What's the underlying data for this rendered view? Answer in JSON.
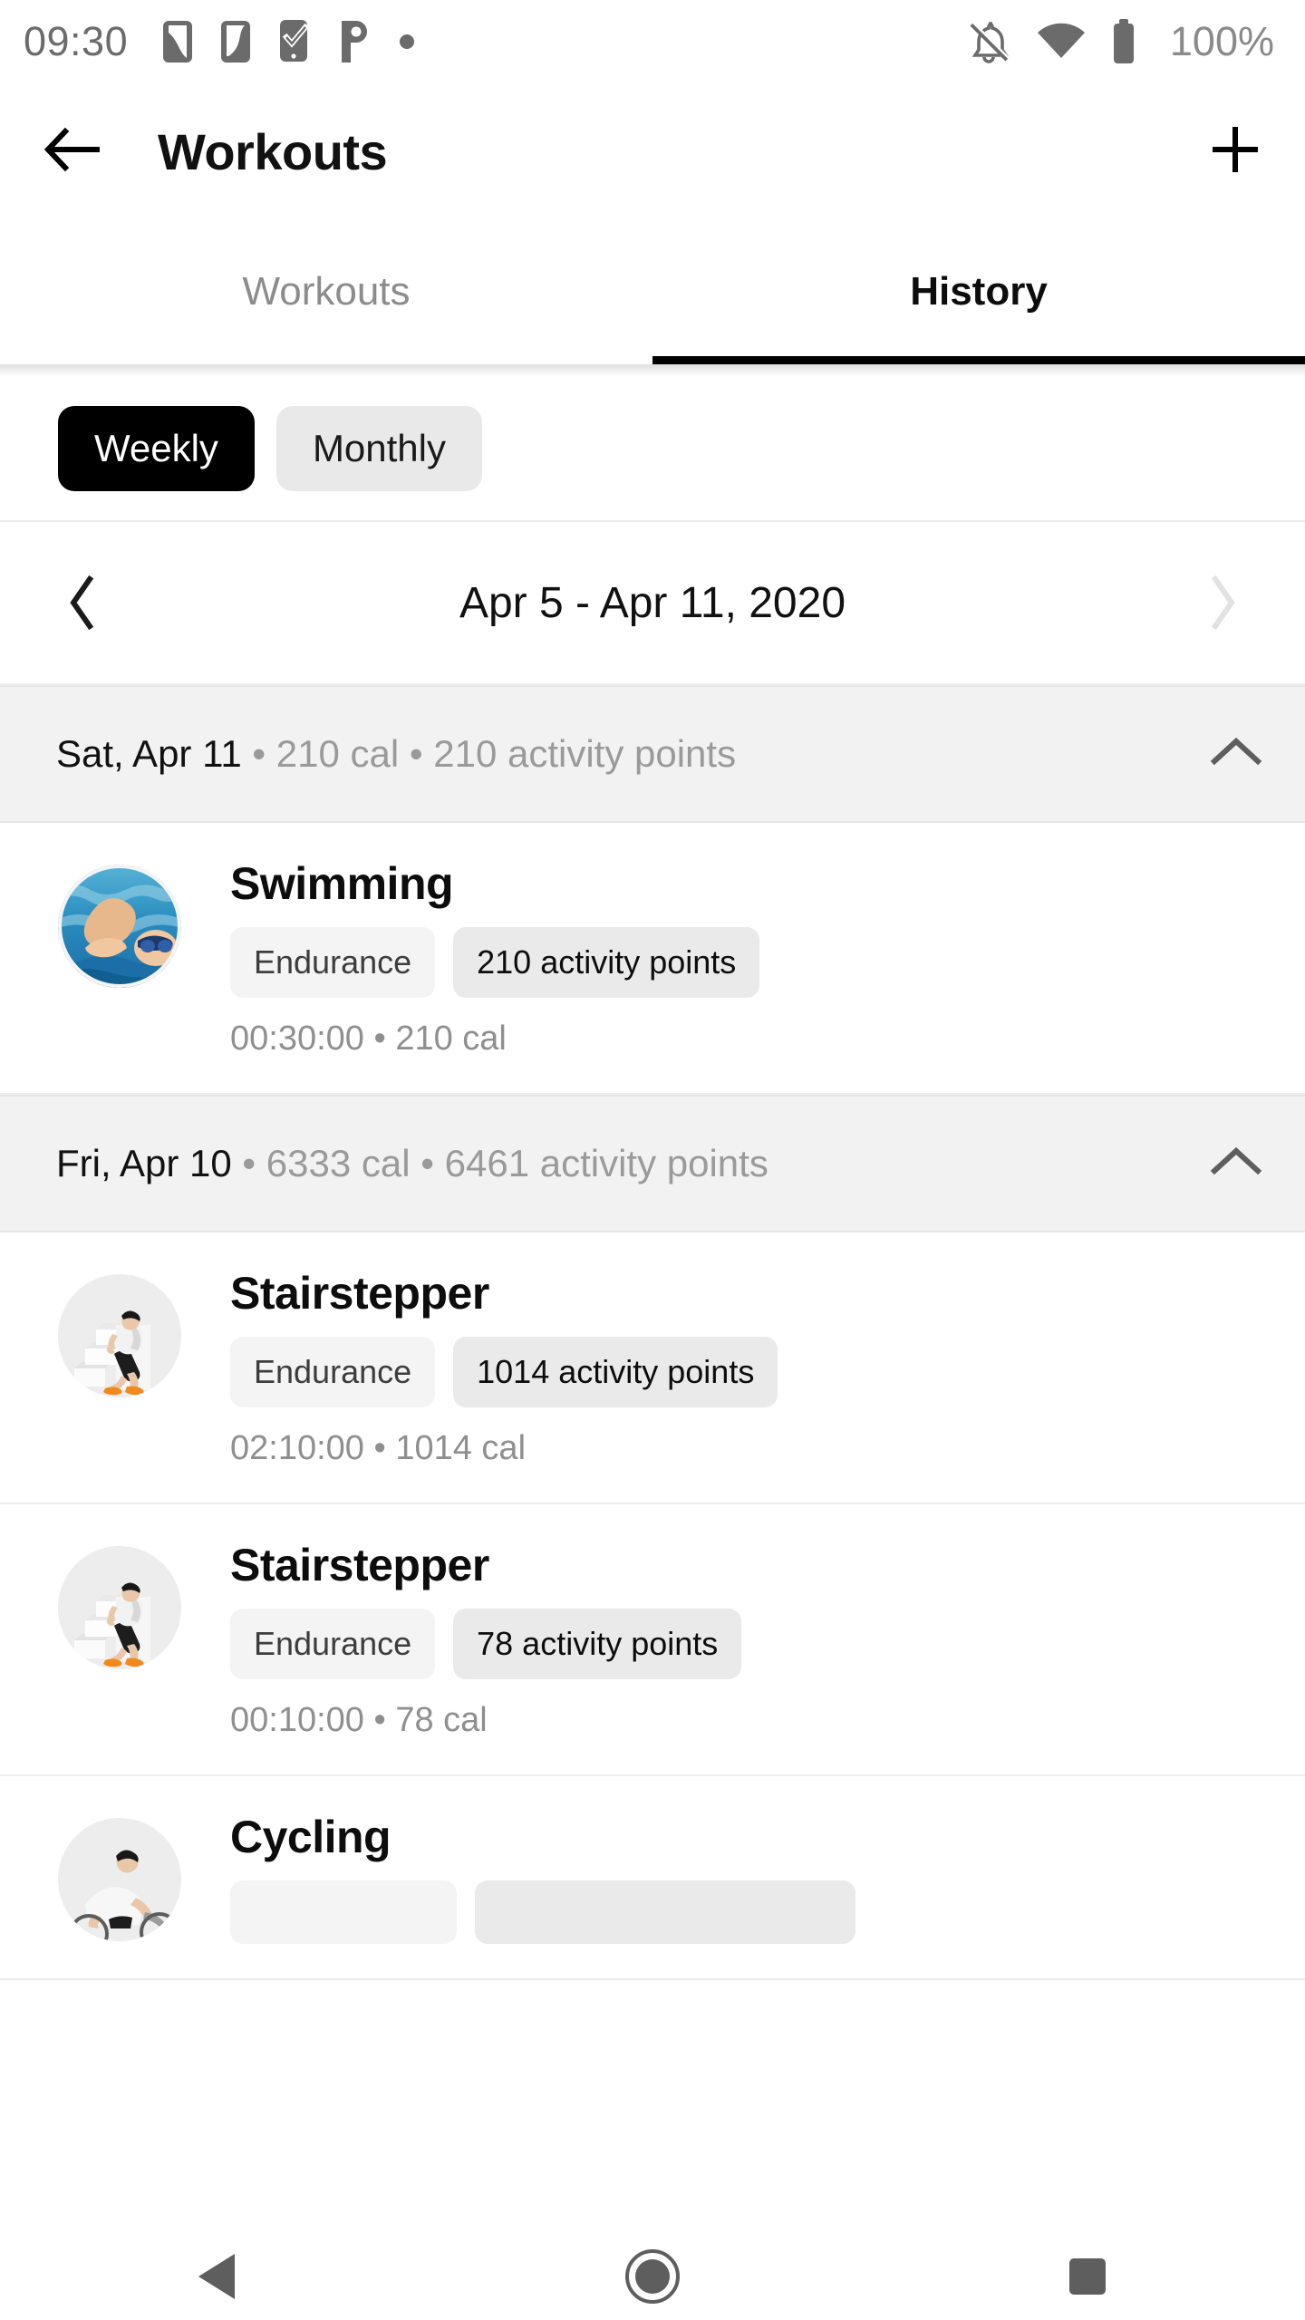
{
  "status_bar": {
    "time": "09:30",
    "battery_percent": "100%",
    "left_icons": [
      "sim-card-icon",
      "sim-card-icon",
      "phone-check-icon",
      "letter-p-icon",
      "dot-icon"
    ],
    "right_icons": [
      "notifications-off-icon",
      "wifi-icon",
      "battery-full-icon"
    ]
  },
  "app_bar": {
    "back_icon": "arrow-back-icon",
    "title": "Workouts",
    "add_icon": "plus-icon"
  },
  "tabs": [
    {
      "label": "Workouts",
      "active": false
    },
    {
      "label": "History",
      "active": true
    }
  ],
  "period_toggle": {
    "options": [
      {
        "label": "Weekly",
        "selected": true
      },
      {
        "label": "Monthly",
        "selected": false
      }
    ]
  },
  "date_nav": {
    "prev_icon": "chevron-left-icon",
    "next_icon": "chevron-right-icon",
    "range_label": "Apr 5 - Apr 11, 2020",
    "prev_enabled": true,
    "next_enabled": false
  },
  "days": [
    {
      "date_label": "Sat, Apr 11",
      "meta": " • 210 cal • 210 activity points",
      "collapse_icon": "chevron-up-icon",
      "workouts": [
        {
          "avatar": "swimming-photo",
          "title": "Swimming",
          "category": "Endurance",
          "points": "210 activity points",
          "meta": "00:30:00 • 210 cal"
        }
      ]
    },
    {
      "date_label": "Fri, Apr 10",
      "meta": " • 6333 cal • 6461 activity points",
      "collapse_icon": "chevron-up-icon",
      "workouts": [
        {
          "avatar": "stairstepper-photo",
          "title": "Stairstepper",
          "category": "Endurance",
          "points": "1014 activity points",
          "meta": "02:10:00 • 1014 cal"
        },
        {
          "avatar": "stairstepper-photo",
          "title": "Stairstepper",
          "category": "Endurance",
          "points": "78 activity points",
          "meta": "00:10:00 • 78 cal"
        },
        {
          "avatar": "cycling-photo",
          "title": "Cycling",
          "category": "",
          "points": "",
          "meta": ""
        }
      ]
    }
  ],
  "nav_bar": {
    "back": "triangle-back-icon",
    "home": "circle-home-icon",
    "recents": "square-recents-icon"
  },
  "colors": {
    "accent": "#000000",
    "muted_text": "#9a9a9a",
    "day_header_bg": "#f2f2f2",
    "chip_category_bg": "#f4f4f4",
    "chip_points_bg": "#eaeaea"
  }
}
